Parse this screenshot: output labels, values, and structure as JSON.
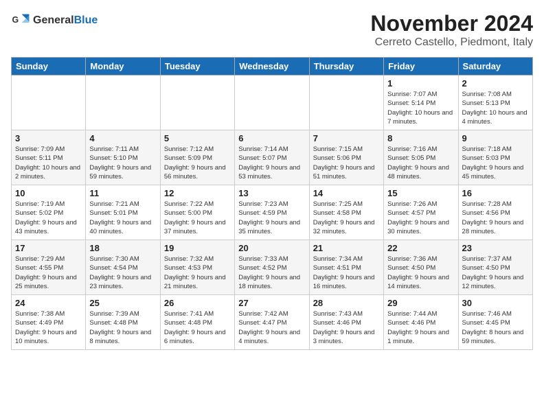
{
  "header": {
    "logo_general": "General",
    "logo_blue": "Blue",
    "month": "November 2024",
    "location": "Cerreto Castello, Piedmont, Italy"
  },
  "weekdays": [
    "Sunday",
    "Monday",
    "Tuesday",
    "Wednesday",
    "Thursday",
    "Friday",
    "Saturday"
  ],
  "weeks": [
    [
      {
        "day": "",
        "info": ""
      },
      {
        "day": "",
        "info": ""
      },
      {
        "day": "",
        "info": ""
      },
      {
        "day": "",
        "info": ""
      },
      {
        "day": "",
        "info": ""
      },
      {
        "day": "1",
        "info": "Sunrise: 7:07 AM\nSunset: 5:14 PM\nDaylight: 10 hours and 7 minutes."
      },
      {
        "day": "2",
        "info": "Sunrise: 7:08 AM\nSunset: 5:13 PM\nDaylight: 10 hours and 4 minutes."
      }
    ],
    [
      {
        "day": "3",
        "info": "Sunrise: 7:09 AM\nSunset: 5:11 PM\nDaylight: 10 hours and 2 minutes."
      },
      {
        "day": "4",
        "info": "Sunrise: 7:11 AM\nSunset: 5:10 PM\nDaylight: 9 hours and 59 minutes."
      },
      {
        "day": "5",
        "info": "Sunrise: 7:12 AM\nSunset: 5:09 PM\nDaylight: 9 hours and 56 minutes."
      },
      {
        "day": "6",
        "info": "Sunrise: 7:14 AM\nSunset: 5:07 PM\nDaylight: 9 hours and 53 minutes."
      },
      {
        "day": "7",
        "info": "Sunrise: 7:15 AM\nSunset: 5:06 PM\nDaylight: 9 hours and 51 minutes."
      },
      {
        "day": "8",
        "info": "Sunrise: 7:16 AM\nSunset: 5:05 PM\nDaylight: 9 hours and 48 minutes."
      },
      {
        "day": "9",
        "info": "Sunrise: 7:18 AM\nSunset: 5:03 PM\nDaylight: 9 hours and 45 minutes."
      }
    ],
    [
      {
        "day": "10",
        "info": "Sunrise: 7:19 AM\nSunset: 5:02 PM\nDaylight: 9 hours and 43 minutes."
      },
      {
        "day": "11",
        "info": "Sunrise: 7:21 AM\nSunset: 5:01 PM\nDaylight: 9 hours and 40 minutes."
      },
      {
        "day": "12",
        "info": "Sunrise: 7:22 AM\nSunset: 5:00 PM\nDaylight: 9 hours and 37 minutes."
      },
      {
        "day": "13",
        "info": "Sunrise: 7:23 AM\nSunset: 4:59 PM\nDaylight: 9 hours and 35 minutes."
      },
      {
        "day": "14",
        "info": "Sunrise: 7:25 AM\nSunset: 4:58 PM\nDaylight: 9 hours and 32 minutes."
      },
      {
        "day": "15",
        "info": "Sunrise: 7:26 AM\nSunset: 4:57 PM\nDaylight: 9 hours and 30 minutes."
      },
      {
        "day": "16",
        "info": "Sunrise: 7:28 AM\nSunset: 4:56 PM\nDaylight: 9 hours and 28 minutes."
      }
    ],
    [
      {
        "day": "17",
        "info": "Sunrise: 7:29 AM\nSunset: 4:55 PM\nDaylight: 9 hours and 25 minutes."
      },
      {
        "day": "18",
        "info": "Sunrise: 7:30 AM\nSunset: 4:54 PM\nDaylight: 9 hours and 23 minutes."
      },
      {
        "day": "19",
        "info": "Sunrise: 7:32 AM\nSunset: 4:53 PM\nDaylight: 9 hours and 21 minutes."
      },
      {
        "day": "20",
        "info": "Sunrise: 7:33 AM\nSunset: 4:52 PM\nDaylight: 9 hours and 18 minutes."
      },
      {
        "day": "21",
        "info": "Sunrise: 7:34 AM\nSunset: 4:51 PM\nDaylight: 9 hours and 16 minutes."
      },
      {
        "day": "22",
        "info": "Sunrise: 7:36 AM\nSunset: 4:50 PM\nDaylight: 9 hours and 14 minutes."
      },
      {
        "day": "23",
        "info": "Sunrise: 7:37 AM\nSunset: 4:50 PM\nDaylight: 9 hours and 12 minutes."
      }
    ],
    [
      {
        "day": "24",
        "info": "Sunrise: 7:38 AM\nSunset: 4:49 PM\nDaylight: 9 hours and 10 minutes."
      },
      {
        "day": "25",
        "info": "Sunrise: 7:39 AM\nSunset: 4:48 PM\nDaylight: 9 hours and 8 minutes."
      },
      {
        "day": "26",
        "info": "Sunrise: 7:41 AM\nSunset: 4:48 PM\nDaylight: 9 hours and 6 minutes."
      },
      {
        "day": "27",
        "info": "Sunrise: 7:42 AM\nSunset: 4:47 PM\nDaylight: 9 hours and 4 minutes."
      },
      {
        "day": "28",
        "info": "Sunrise: 7:43 AM\nSunset: 4:46 PM\nDaylight: 9 hours and 3 minutes."
      },
      {
        "day": "29",
        "info": "Sunrise: 7:44 AM\nSunset: 4:46 PM\nDaylight: 9 hours and 1 minute."
      },
      {
        "day": "30",
        "info": "Sunrise: 7:46 AM\nSunset: 4:45 PM\nDaylight: 8 hours and 59 minutes."
      }
    ]
  ]
}
